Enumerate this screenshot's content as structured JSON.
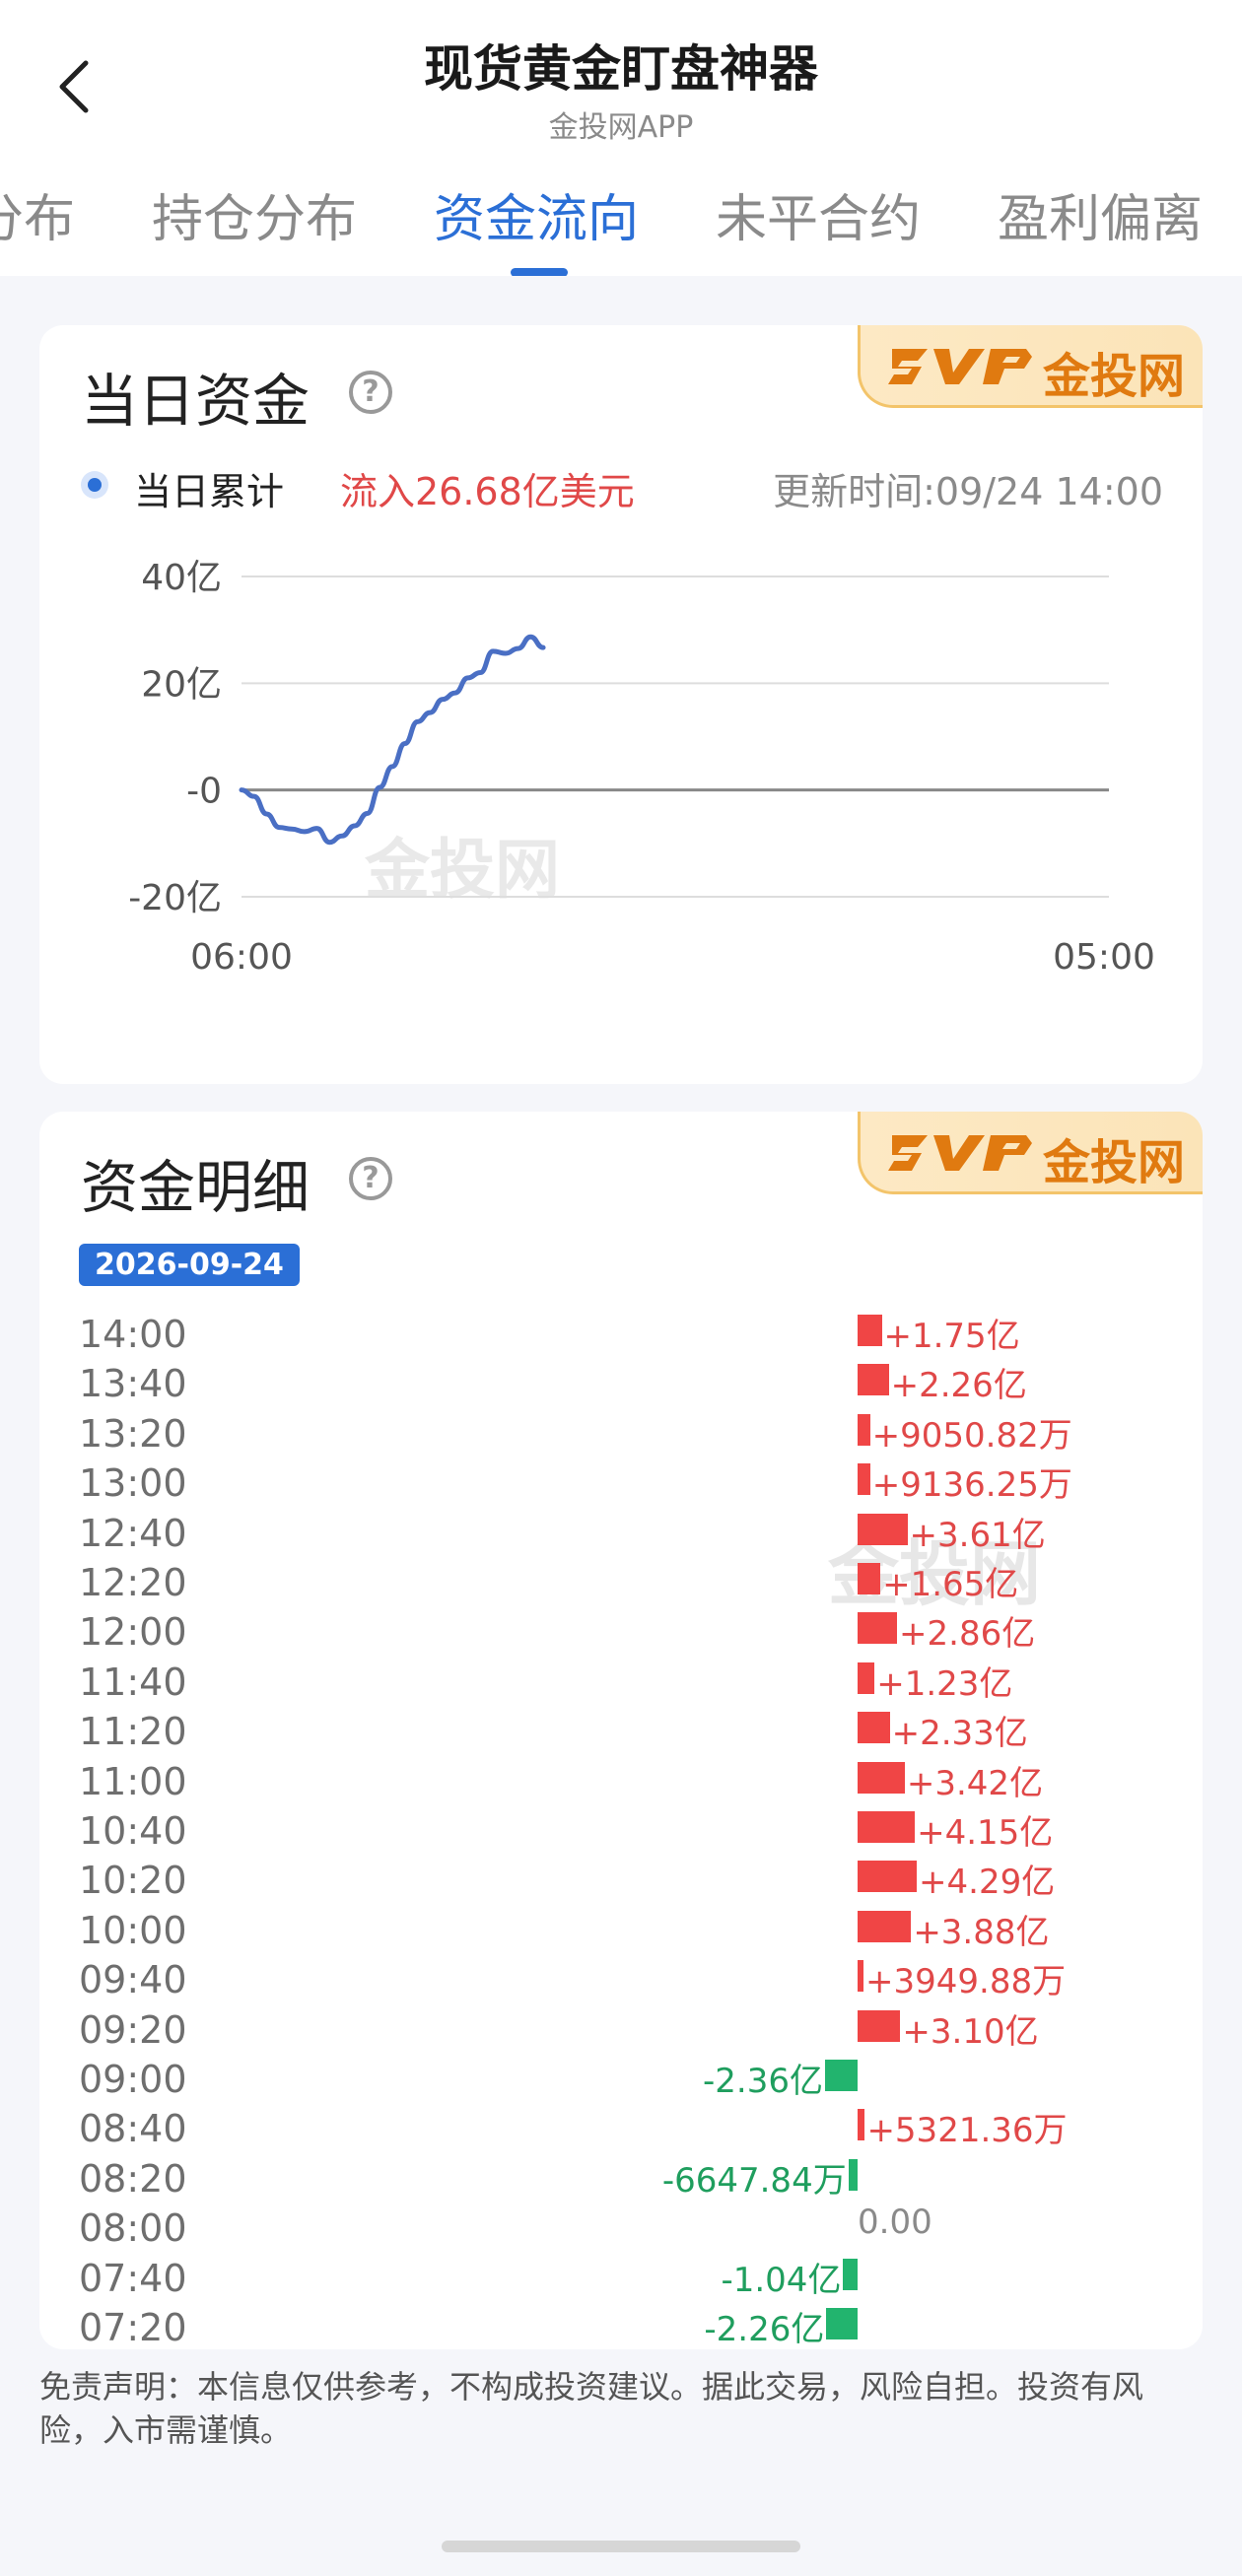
{
  "header": {
    "title": "现货黄金盯盘神器",
    "subtitle": "金投网APP"
  },
  "tabs": [
    {
      "label": "分布",
      "active": false
    },
    {
      "label": "持仓分布",
      "active": false
    },
    {
      "label": "资金流向",
      "active": true
    },
    {
      "label": "未平合约",
      "active": false
    },
    {
      "label": "盈利偏离",
      "active": false
    }
  ],
  "brand": {
    "badge_text": "金投网",
    "watermark": "金投网"
  },
  "daily_card": {
    "title": "当日资金",
    "help_icon": "question-circle-icon",
    "legend_label": "当日累计",
    "inflow_text": "流入26.68亿美元",
    "updated_text": "更新时间:09/24 14:00"
  },
  "chart_data": {
    "type": "line",
    "title": "",
    "xlabel": "",
    "ylabel": "",
    "x_tick_labels": [
      "06:00",
      "05:00"
    ],
    "y_tick_labels": [
      "40亿",
      "20亿",
      "-0",
      "-20亿"
    ],
    "ylim": [
      -20,
      40
    ],
    "grid": true,
    "series": [
      {
        "name": "当日累计",
        "color": "#4a6fc4",
        "unit": "亿",
        "x": [
          "06:00",
          "06:20",
          "06:40",
          "07:00",
          "07:20",
          "07:40",
          "08:00",
          "08:20",
          "08:40",
          "09:00",
          "09:20",
          "09:40",
          "10:00",
          "10:20",
          "10:40",
          "11:00",
          "11:20",
          "11:40",
          "12:00",
          "12:20",
          "12:40",
          "13:00",
          "13:20",
          "13:40",
          "14:00"
        ],
        "y": [
          0,
          -1.2,
          -4.5,
          -7.0,
          -7.3,
          -7.8,
          -7.2,
          -9.8,
          -8.6,
          -6.7,
          -4.4,
          0.5,
          4.4,
          8.7,
          12.8,
          14.5,
          17.0,
          18.2,
          21.0,
          22.0,
          26.0,
          25.6,
          26.5,
          28.7,
          26.68
        ]
      }
    ],
    "x_range": [
      "06:00",
      "05:00"
    ]
  },
  "detail_card": {
    "title": "资金明细",
    "help_icon": "question-circle-icon",
    "date": "2026-09-24",
    "rows": [
      {
        "time": "14:00",
        "value": "+1.75亿",
        "amount_yi": 1.75
      },
      {
        "time": "13:40",
        "value": "+2.26亿",
        "amount_yi": 2.26
      },
      {
        "time": "13:20",
        "value": "+9050.82万",
        "amount_yi": 0.905
      },
      {
        "time": "13:00",
        "value": "+9136.25万",
        "amount_yi": 0.914
      },
      {
        "time": "12:40",
        "value": "+3.61亿",
        "amount_yi": 3.61
      },
      {
        "time": "12:20",
        "value": "+1.65亿",
        "amount_yi": 1.65
      },
      {
        "time": "12:00",
        "value": "+2.86亿",
        "amount_yi": 2.86
      },
      {
        "time": "11:40",
        "value": "+1.23亿",
        "amount_yi": 1.23
      },
      {
        "time": "11:20",
        "value": "+2.33亿",
        "amount_yi": 2.33
      },
      {
        "time": "11:00",
        "value": "+3.42亿",
        "amount_yi": 3.42
      },
      {
        "time": "10:40",
        "value": "+4.15亿",
        "amount_yi": 4.15
      },
      {
        "time": "10:20",
        "value": "+4.29亿",
        "amount_yi": 4.29
      },
      {
        "time": "10:00",
        "value": "+3.88亿",
        "amount_yi": 3.88
      },
      {
        "time": "09:40",
        "value": "+3949.88万",
        "amount_yi": 0.395
      },
      {
        "time": "09:20",
        "value": "+3.10亿",
        "amount_yi": 3.1
      },
      {
        "time": "09:00",
        "value": "-2.36亿",
        "amount_yi": -2.36
      },
      {
        "time": "08:40",
        "value": "+5321.36万",
        "amount_yi": 0.532
      },
      {
        "time": "08:20",
        "value": "-6647.84万",
        "amount_yi": -0.665
      },
      {
        "time": "08:00",
        "value": "0.00",
        "amount_yi": 0
      },
      {
        "time": "07:40",
        "value": "-1.04亿",
        "amount_yi": -1.04
      },
      {
        "time": "07:20",
        "value": "-2.26亿",
        "amount_yi": -2.26
      }
    ]
  },
  "colors": {
    "accent": "#2b6fd6",
    "positive": "#f04545",
    "negative": "#22b46e",
    "line": "#4a6fc4"
  },
  "disclaimer": "免责声明：本信息仅供参考，不构成投资建议。据此交易，风险自担。投资有风险，入市需谨慎。"
}
